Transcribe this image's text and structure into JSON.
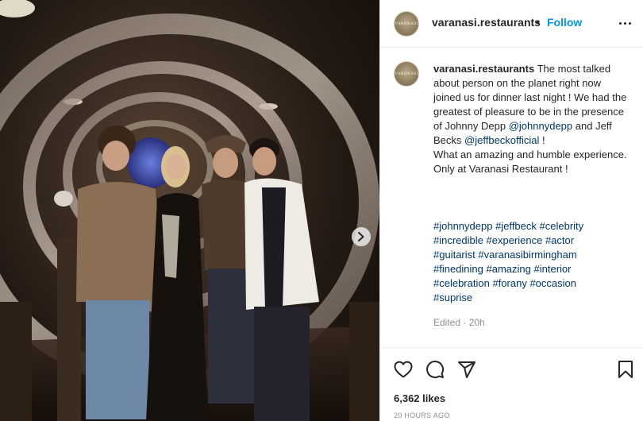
{
  "post": {
    "username": "varanasi.restaurants",
    "separator": "•",
    "follow_label": "Follow",
    "avatar_text": "VARANASI",
    "caption": {
      "username": "varanasi.restaurants",
      "line1": "The most talked about person on the planet right now joined us for dinner last night ! We had the greatest of pleasure to be in the presence of Johnny Depp",
      "mention1": "@johnnydepp",
      "and_text": "and Jeff Becks",
      "mention2": "@jeffbeckofficial",
      "exclaim": "!",
      "line2": "What an amazing and humble experience. Only at Varanasi Restaurant !"
    },
    "hashtags": [
      "#johnnydepp",
      "#jeffbeck",
      "#celebrity",
      "#incredible",
      "#experience",
      "#actor",
      "#guitarist",
      "#varanasibirmingham",
      "#finedining",
      "#amazing",
      "#interior",
      "#celebration",
      "#forany",
      "#occasion",
      "#suprise"
    ],
    "edited": "Edited · 20h",
    "likes": "6,362 likes",
    "timestamp": "20 HOURS AGO"
  },
  "icons": {
    "more": "more-options-icon",
    "like": "heart-icon",
    "comment": "comment-icon",
    "share": "share-icon",
    "save": "bookmark-icon",
    "next": "chevron-right-icon"
  },
  "colors": {
    "link": "#00376b",
    "follow": "#0095f6",
    "muted": "#8e8e8e",
    "border": "#efefef"
  }
}
